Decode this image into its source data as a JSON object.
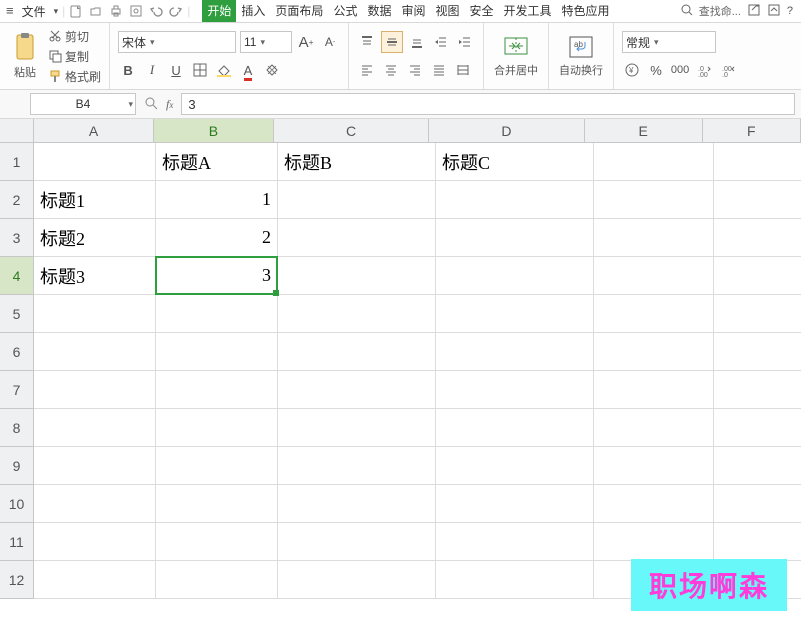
{
  "menu": {
    "file": "文件",
    "tabs": [
      "开始",
      "插入",
      "页面布局",
      "公式",
      "数据",
      "审阅",
      "视图",
      "安全",
      "开发工具",
      "特色应用"
    ],
    "search_placeholder": "查找命..."
  },
  "clipboard": {
    "paste": "粘贴",
    "cut": "剪切",
    "copy": "复制",
    "format_painter": "格式刷"
  },
  "font": {
    "name": "宋体",
    "size": "11"
  },
  "merge": {
    "label": "合并居中"
  },
  "wrap": {
    "label": "自动换行"
  },
  "number_format": {
    "label": "常规"
  },
  "name_box": "B4",
  "formula_value": "3",
  "columns": [
    "A",
    "B",
    "C",
    "D",
    "E",
    "F"
  ],
  "rows": [
    "1",
    "2",
    "3",
    "4",
    "5",
    "6",
    "7",
    "8",
    "9",
    "10",
    "11",
    "12"
  ],
  "cells": {
    "B1": "标题A",
    "C1": "标题B",
    "D1": "标题C",
    "A2": "标题1",
    "A3": "标题2",
    "A4": "标题3",
    "B2": "1",
    "B3": "2",
    "B4": "3"
  },
  "selection": {
    "col": "B",
    "row": 4
  },
  "watermark": "职场啊森"
}
